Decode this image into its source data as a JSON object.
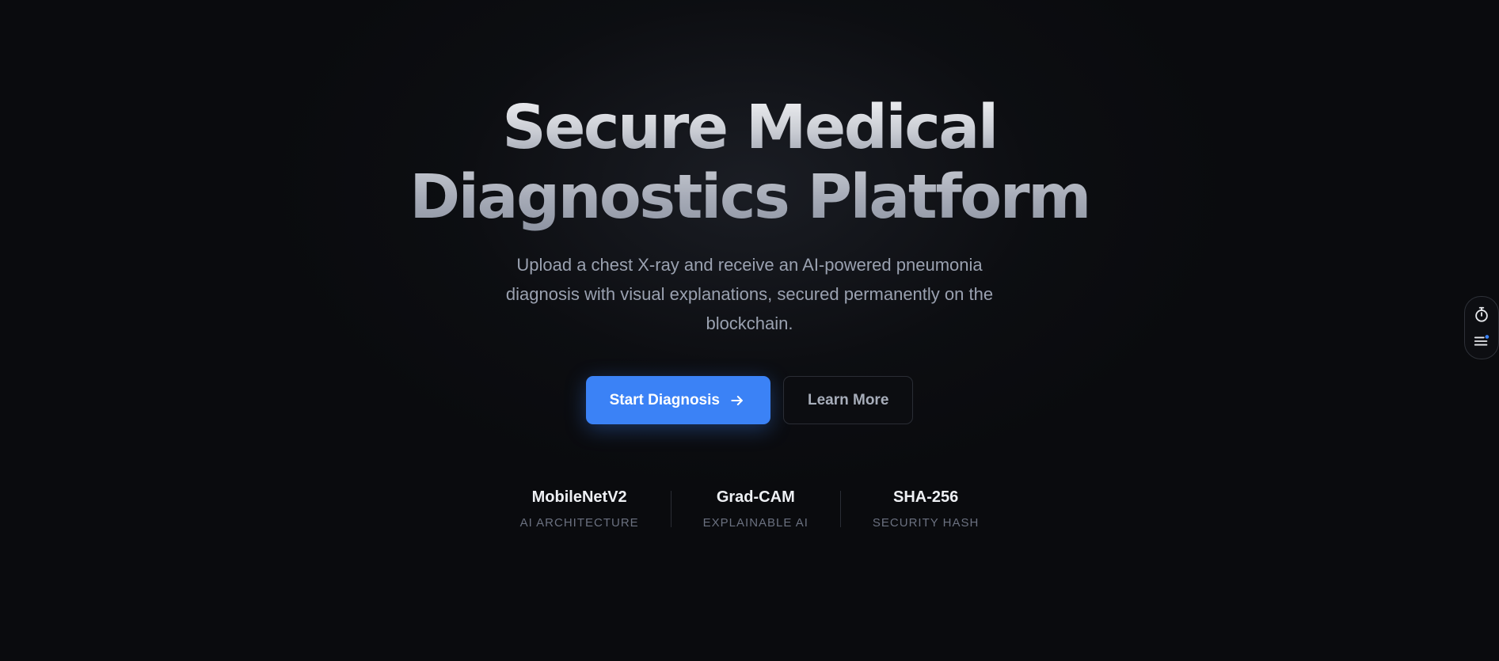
{
  "hero": {
    "title_line1": "Secure Medical",
    "title_line2": "Diagnostics Platform",
    "subtitle": "Upload a chest X-ray and receive an AI-powered pneumonia diagnosis with visual explanations, secured permanently on the blockchain."
  },
  "actions": {
    "primary_label": "Start Diagnosis",
    "primary_icon": "arrow-right-icon",
    "secondary_label": "Learn More"
  },
  "stats": [
    {
      "value": "MobileNetV2",
      "label": "AI ARCHITECTURE"
    },
    {
      "value": "Grad-CAM",
      "label": "EXPLAINABLE AI"
    },
    {
      "value": "SHA-256",
      "label": "SECURITY HASH"
    }
  ],
  "side_widget": {
    "icons": [
      "stopwatch-icon",
      "menu-notification-icon"
    ]
  },
  "colors": {
    "background": "#0a0b0e",
    "accent": "#3b82f6",
    "subtitle_text": "#9aa1b0",
    "stat_label": "#6b7180"
  }
}
